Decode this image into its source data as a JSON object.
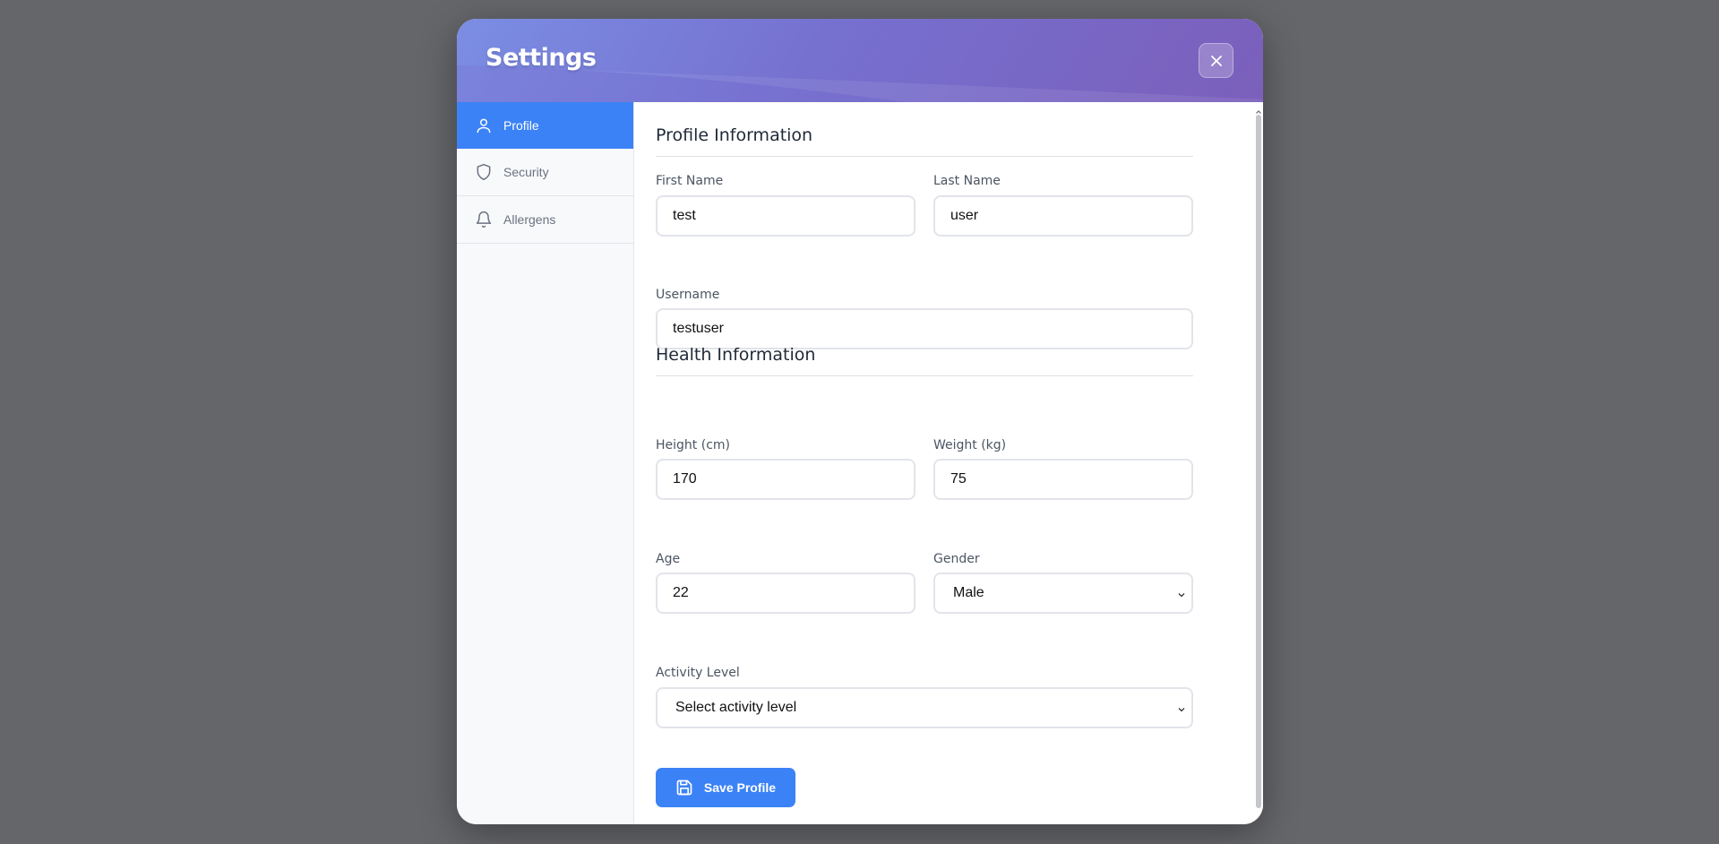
{
  "header": {
    "title": "Settings"
  },
  "sidebar": {
    "items": [
      {
        "label": "Profile",
        "icon": "user-icon",
        "active": true
      },
      {
        "label": "Security",
        "icon": "shield-icon",
        "active": false
      },
      {
        "label": "Allergens",
        "icon": "bell-icon",
        "active": false
      }
    ]
  },
  "profile": {
    "title": "Profile Information",
    "first_name_label": "First Name",
    "first_name_value": "test",
    "last_name_label": "Last Name",
    "last_name_value": "user",
    "username_label": "Username",
    "username_value": "testuser"
  },
  "health": {
    "title": "Health Information",
    "height_label": "Height (cm)",
    "height_value": "170",
    "weight_label": "Weight (kg)",
    "weight_value": "75",
    "age_label": "Age",
    "age_value": "22",
    "gender_label": "Gender",
    "gender_value": "Male",
    "activity_label": "Activity Level",
    "activity_value": "Select activity level"
  },
  "actions": {
    "save_label": "Save Profile"
  },
  "colors": {
    "accent": "#3b82f6",
    "header_gradient_start": "#7b8ee3",
    "header_gradient_end": "#7b5fbb",
    "overlay": "#65666a"
  }
}
